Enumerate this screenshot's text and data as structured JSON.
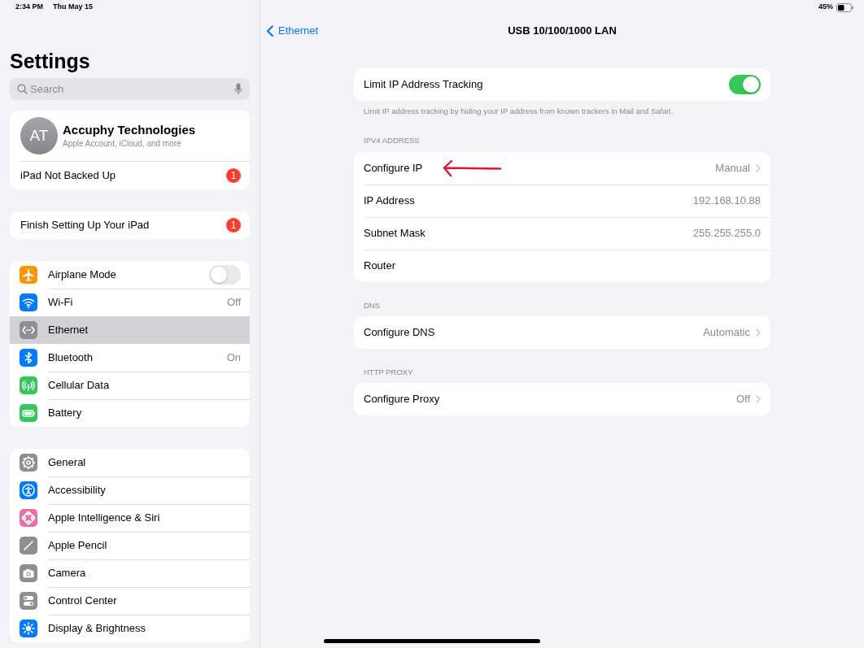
{
  "status_bar": {
    "time": "2:34 PM",
    "date": "Thu May 15",
    "battery": "45%"
  },
  "sidebar": {
    "title": "Settings",
    "search": {
      "placeholder": "Search"
    },
    "account": {
      "initials": "AT",
      "name": "Accuphy Technologies",
      "subtitle": "Apple Account, iCloud, and more",
      "alert": {
        "label": "iPad Not Backed Up",
        "badge": "1"
      }
    },
    "setup": {
      "label": "Finish Setting Up Your iPad",
      "badge": "1"
    },
    "groups": [
      {
        "items": [
          {
            "label": "Airplane Mode",
            "color": "#ff9500",
            "kind": "toggle",
            "on": false,
            "selected": false
          },
          {
            "label": "Wi-Fi",
            "color": "#007aff",
            "kind": "value",
            "value": "Off",
            "selected": false
          },
          {
            "label": "Ethernet",
            "color": "#8e8e93",
            "kind": "plain",
            "selected": true
          },
          {
            "label": "Bluetooth",
            "color": "#007aff",
            "kind": "value",
            "value": "On",
            "selected": false
          },
          {
            "label": "Cellular Data",
            "color": "#34c759",
            "kind": "plain",
            "selected": false
          },
          {
            "label": "Battery",
            "color": "#34c759",
            "kind": "plain",
            "selected": false
          }
        ]
      },
      {
        "items": [
          {
            "label": "General",
            "color": "#8e8e93",
            "kind": "plain",
            "selected": false
          },
          {
            "label": "Accessibility",
            "color": "#007aff",
            "kind": "plain",
            "selected": false
          },
          {
            "label": "Apple Intelligence & Siri",
            "color": "#e86fa8",
            "kind": "plain",
            "selected": false
          },
          {
            "label": "Apple Pencil",
            "color": "#8e8e93",
            "kind": "plain",
            "selected": false
          },
          {
            "label": "Camera",
            "color": "#8e8e93",
            "kind": "plain",
            "selected": false
          },
          {
            "label": "Control Center",
            "color": "#8e8e93",
            "kind": "plain",
            "selected": false
          },
          {
            "label": "Display & Brightness",
            "color": "#007aff",
            "kind": "plain",
            "selected": false
          }
        ]
      }
    ]
  },
  "detail": {
    "back": "Ethernet",
    "title": "USB 10/100/1000 LAN",
    "sections": [
      {
        "rows": [
          {
            "label": "Limit IP Address Tracking",
            "kind": "toggle",
            "on": true
          }
        ],
        "footer": "Limit IP address tracking by hiding your IP address from known trackers in Mail and Safari."
      },
      {
        "header": "IPV4 ADDRESS",
        "rows": [
          {
            "label": "Configure IP",
            "kind": "link",
            "value": "Manual",
            "annotated": true
          },
          {
            "label": "IP Address",
            "kind": "info",
            "value": "192.168.10.88"
          },
          {
            "label": "Subnet Mask",
            "kind": "info",
            "value": "255.255.255.0"
          },
          {
            "label": "Router",
            "kind": "plain"
          }
        ]
      },
      {
        "header": "DNS",
        "rows": [
          {
            "label": "Configure DNS",
            "kind": "link",
            "value": "Automatic"
          }
        ]
      },
      {
        "header": "HTTP PROXY",
        "rows": [
          {
            "label": "Configure Proxy",
            "kind": "link",
            "value": "Off"
          }
        ]
      }
    ]
  }
}
